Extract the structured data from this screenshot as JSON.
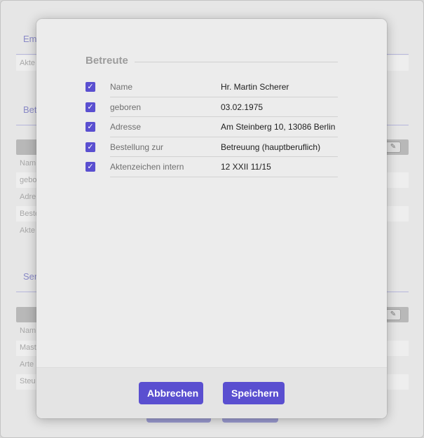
{
  "background": {
    "section1": {
      "heading": "Em",
      "row": "Akte"
    },
    "section2": {
      "heading": "Bet",
      "rows": [
        "Nam",
        "gebo",
        "Adre",
        "Beste",
        "Akte"
      ]
    },
    "section3": {
      "heading": "Ser",
      "rows": [
        "Nam",
        "Mast",
        "Arte",
        "Steu"
      ]
    },
    "edit_icon": "edit-icon"
  },
  "modal": {
    "section_title": "Betreute",
    "fields": [
      {
        "label": "Name",
        "value": "Hr. Martin Scherer",
        "checked": true
      },
      {
        "label": "geboren",
        "value": "03.02.1975",
        "checked": true
      },
      {
        "label": "Adresse",
        "value": "Am Steinberg 10, 13086 Berlin",
        "checked": true
      },
      {
        "label": "Bestellung zur",
        "value": "Betreuung (hauptberuflich)",
        "checked": true
      },
      {
        "label": "Aktenzeichen intern",
        "value": "12 XXII 11/15",
        "checked": true
      }
    ],
    "checkmark": "✓",
    "buttons": {
      "cancel": "Abbrechen",
      "save": "Speichern"
    }
  },
  "colors": {
    "accent": "#5a4fd0",
    "background": "#ececec"
  }
}
